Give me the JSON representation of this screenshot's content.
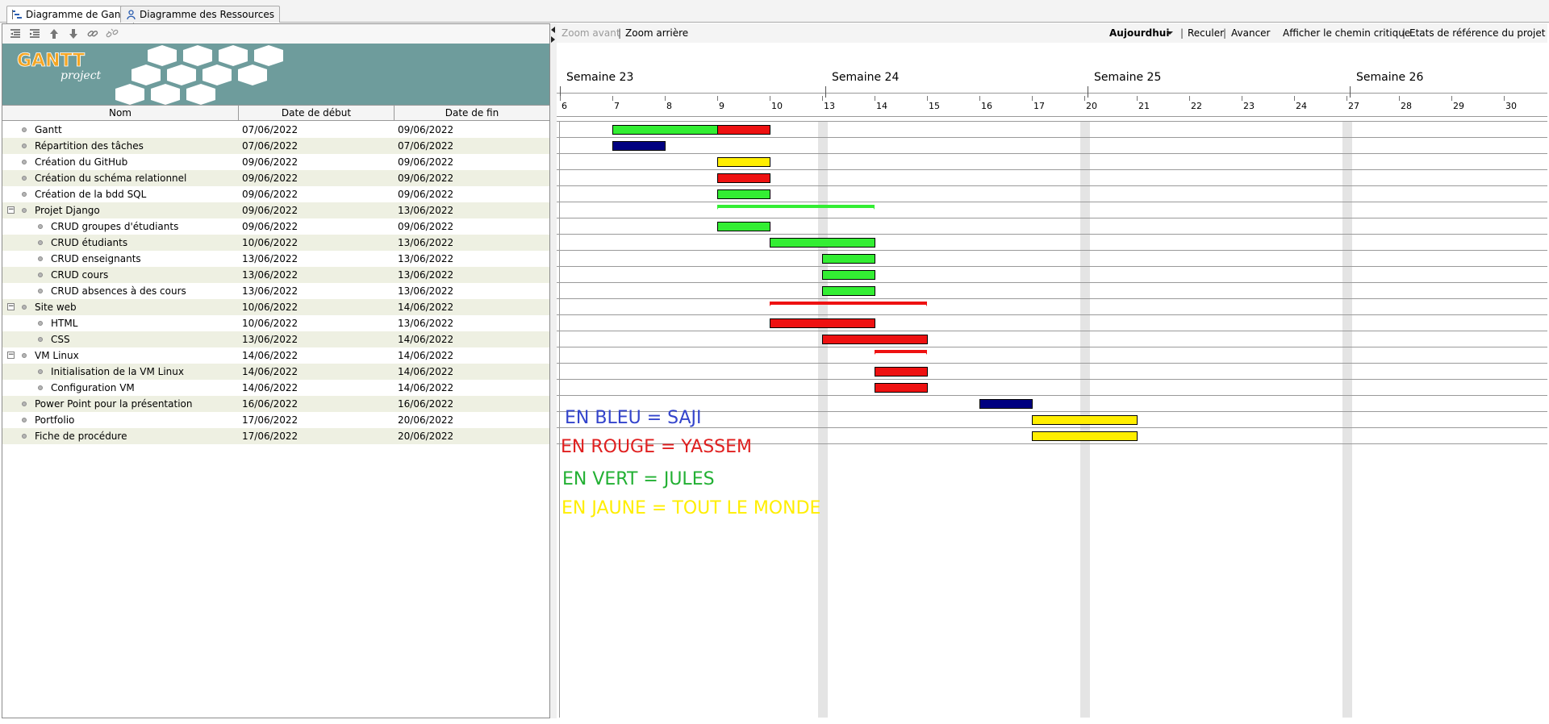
{
  "tabs": [
    {
      "label": "Diagramme de Gantt",
      "active": true,
      "icon": "gantt-chart-icon"
    },
    {
      "label": "Diagramme des Ressources",
      "active": false,
      "icon": "resources-icon"
    }
  ],
  "left_toolbar": {
    "icons": [
      "outdent-icon",
      "indent-icon",
      "move-up-icon",
      "move-down-icon",
      "link-icon",
      "unlink-icon"
    ]
  },
  "banner": {
    "logo_text": "GANTT",
    "logo_sub": "project",
    "color": "#6e9c9c"
  },
  "table": {
    "columns": [
      "Nom",
      "Date de début",
      "Date de fin"
    ],
    "rows": [
      {
        "name": "Gantt",
        "start": "07/06/2022",
        "end": "09/06/2022",
        "level": 0,
        "collapsible": false
      },
      {
        "name": "Répartition des tâches",
        "start": "07/06/2022",
        "end": "07/06/2022",
        "level": 0,
        "collapsible": false
      },
      {
        "name": "Création du GitHub",
        "start": "09/06/2022",
        "end": "09/06/2022",
        "level": 0,
        "collapsible": false
      },
      {
        "name": "Création du schéma relationnel",
        "start": "09/06/2022",
        "end": "09/06/2022",
        "level": 0,
        "collapsible": false
      },
      {
        "name": "Création de la bdd SQL",
        "start": "09/06/2022",
        "end": "09/06/2022",
        "level": 0,
        "collapsible": false
      },
      {
        "name": "Projet Django",
        "start": "09/06/2022",
        "end": "13/06/2022",
        "level": 0,
        "collapsible": true
      },
      {
        "name": "CRUD groupes d'étudiants",
        "start": "09/06/2022",
        "end": "09/06/2022",
        "level": 1,
        "collapsible": false
      },
      {
        "name": "CRUD étudiants",
        "start": "10/06/2022",
        "end": "13/06/2022",
        "level": 1,
        "collapsible": false
      },
      {
        "name": "CRUD enseignants",
        "start": "13/06/2022",
        "end": "13/06/2022",
        "level": 1,
        "collapsible": false
      },
      {
        "name": "CRUD cours",
        "start": "13/06/2022",
        "end": "13/06/2022",
        "level": 1,
        "collapsible": false
      },
      {
        "name": "CRUD absences à des cours",
        "start": "13/06/2022",
        "end": "13/06/2022",
        "level": 1,
        "collapsible": false
      },
      {
        "name": "Site web",
        "start": "10/06/2022",
        "end": "14/06/2022",
        "level": 0,
        "collapsible": true
      },
      {
        "name": "HTML",
        "start": "10/06/2022",
        "end": "13/06/2022",
        "level": 1,
        "collapsible": false
      },
      {
        "name": "CSS",
        "start": "13/06/2022",
        "end": "14/06/2022",
        "level": 1,
        "collapsible": false
      },
      {
        "name": "VM Linux",
        "start": "14/06/2022",
        "end": "14/06/2022",
        "level": 0,
        "collapsible": true
      },
      {
        "name": "Initialisation de la VM Linux",
        "start": "14/06/2022",
        "end": "14/06/2022",
        "level": 1,
        "collapsible": false
      },
      {
        "name": "Configuration VM",
        "start": "14/06/2022",
        "end": "14/06/2022",
        "level": 1,
        "collapsible": false
      },
      {
        "name": "Power Point pour la présentation",
        "start": "16/06/2022",
        "end": "16/06/2022",
        "level": 0,
        "collapsible": false
      },
      {
        "name": "Portfolio",
        "start": "17/06/2022",
        "end": "20/06/2022",
        "level": 0,
        "collapsible": false
      },
      {
        "name": "Fiche de procédure",
        "start": "17/06/2022",
        "end": "20/06/2022",
        "level": 0,
        "collapsible": false
      }
    ]
  },
  "right_toolbar": {
    "zoom_in": "Zoom avant",
    "zoom_out": "Zoom arrière",
    "today": "Aujourdhui",
    "back": "Reculer",
    "forward": "Avancer",
    "critical_path": "Afficher le chemin critique",
    "baselines": "Etats de référence du projet ..."
  },
  "timeline": {
    "weeks": [
      "Semaine 23",
      "Semaine 24",
      "Semaine 25",
      "Semaine 26"
    ],
    "days": [
      "6",
      "7",
      "8",
      "9",
      "10",
      "13",
      "14",
      "15",
      "16",
      "17",
      "20",
      "21",
      "22",
      "23",
      "24",
      "27",
      "28",
      "29",
      "30"
    ],
    "weekend_shading": "#e4e4e4"
  },
  "bars": [
    {
      "row": 0,
      "start": "7",
      "end": "9",
      "color": "#33ee33",
      "type": "task",
      "extra": {
        "start": "9",
        "end": "10",
        "color": "#ee1111"
      }
    },
    {
      "row": 1,
      "start": "7",
      "end": "8",
      "color": "#000080",
      "type": "task"
    },
    {
      "row": 2,
      "start": "9",
      "end": "10",
      "color": "#ffee00",
      "type": "task"
    },
    {
      "row": 3,
      "start": "9",
      "end": "10",
      "color": "#ee1111",
      "type": "task"
    },
    {
      "row": 4,
      "start": "9",
      "end": "10",
      "color": "#33ee33",
      "type": "task"
    },
    {
      "row": 5,
      "start": "9",
      "end": "14",
      "color": "#33ee33",
      "type": "summary"
    },
    {
      "row": 6,
      "start": "9",
      "end": "10",
      "color": "#33ee33",
      "type": "task"
    },
    {
      "row": 7,
      "start": "10",
      "end": "14",
      "color": "#33ee33",
      "type": "task"
    },
    {
      "row": 8,
      "start": "13",
      "end": "14",
      "color": "#33ee33",
      "type": "task"
    },
    {
      "row": 9,
      "start": "13",
      "end": "14",
      "color": "#33ee33",
      "type": "task"
    },
    {
      "row": 10,
      "start": "13",
      "end": "14",
      "color": "#33ee33",
      "type": "task"
    },
    {
      "row": 11,
      "start": "10",
      "end": "15",
      "color": "#ee1111",
      "type": "summary"
    },
    {
      "row": 12,
      "start": "10",
      "end": "14",
      "color": "#ee1111",
      "type": "task"
    },
    {
      "row": 13,
      "start": "13",
      "end": "15",
      "color": "#ee1111",
      "type": "task"
    },
    {
      "row": 14,
      "start": "14",
      "end": "15",
      "color": "#ee1111",
      "type": "summary"
    },
    {
      "row": 15,
      "start": "14",
      "end": "15",
      "color": "#ee1111",
      "type": "task"
    },
    {
      "row": 16,
      "start": "14",
      "end": "15",
      "color": "#ee1111",
      "type": "task"
    },
    {
      "row": 17,
      "start": "16",
      "end": "17",
      "color": "#000080",
      "type": "task"
    },
    {
      "row": 18,
      "start": "17",
      "end": "21",
      "color": "#ffee00",
      "type": "task"
    },
    {
      "row": 19,
      "start": "17",
      "end": "21",
      "color": "#ffee00",
      "type": "task"
    }
  ],
  "legend": [
    {
      "text": "EN BLEU = SAJI",
      "color": "#3344cc"
    },
    {
      "text": "EN ROUGE = YASSEM",
      "color": "#e02020"
    },
    {
      "text": "EN VERT = JULES",
      "color": "#22b033"
    },
    {
      "text": "EN JAUNE = TOUT LE MONDE",
      "color": "#ffee00"
    }
  ]
}
